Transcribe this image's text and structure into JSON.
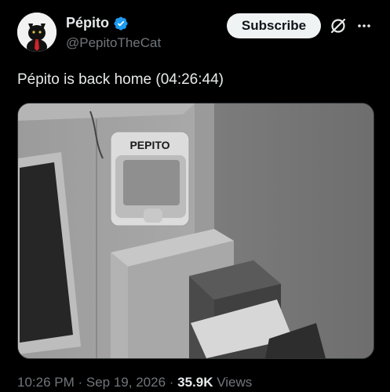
{
  "author": {
    "display_name": "Pépito",
    "handle": "@PepitoTheCat",
    "verified": true,
    "verified_color": "#1d9bf0"
  },
  "actions": {
    "subscribe_label": "Subscribe",
    "grok_icon": "grok-icon",
    "more_icon": "more-icon"
  },
  "tweet": {
    "text": "Pépito is back home (04:26:44)"
  },
  "media": {
    "cat_flap_label": "PEPITO"
  },
  "meta": {
    "time": "10:26 PM",
    "sep1": " · ",
    "date": "Sep 19, 2026",
    "sep2": " · ",
    "views_count": "35.9K",
    "views_label": " Views"
  }
}
